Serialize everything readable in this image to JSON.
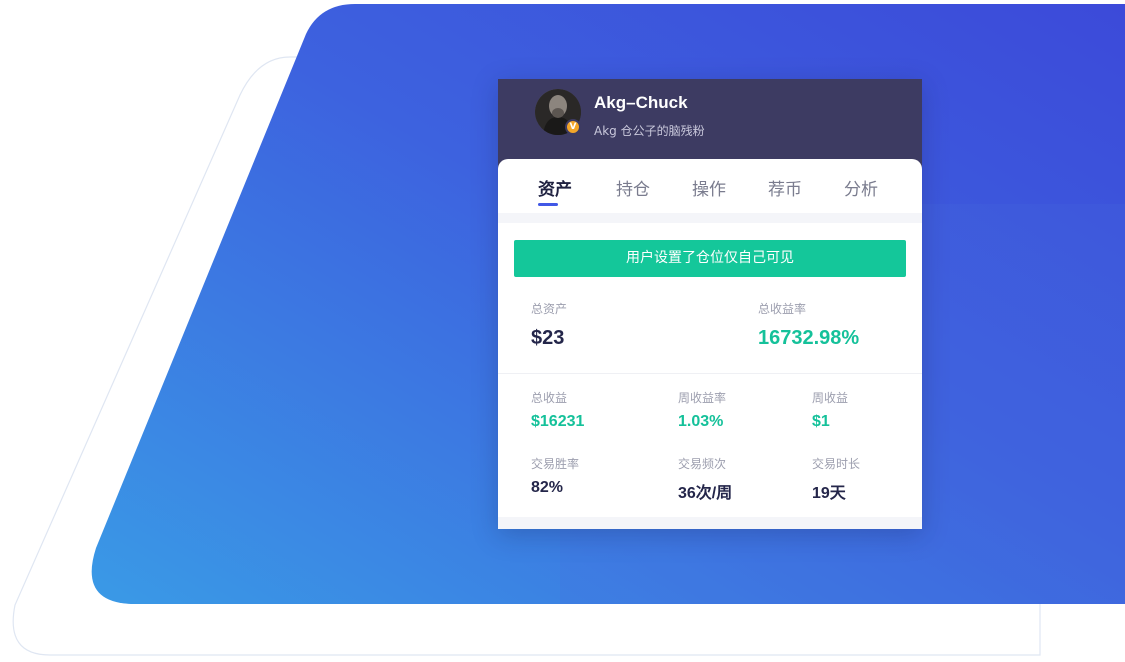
{
  "profile": {
    "name": "Akg–Chuck",
    "subtitle": "Akg 仓公子的脑残粉",
    "badge": "V"
  },
  "tabs": [
    {
      "label": "资产",
      "active": true
    },
    {
      "label": "持仓",
      "active": false
    },
    {
      "label": "操作",
      "active": false
    },
    {
      "label": "荐币",
      "active": false
    },
    {
      "label": "分析",
      "active": false
    }
  ],
  "notice": "用户设置了仓位仅自己可见",
  "summary": {
    "total_assets_label": "总资产",
    "total_assets_value": "$23",
    "total_return_rate_label": "总收益率",
    "total_return_rate_value": "16732.98%"
  },
  "stats": {
    "total_profit_label": "总收益",
    "total_profit_value": "$16231",
    "weekly_return_rate_label": "周收益率",
    "weekly_return_rate_value": "1.03%",
    "weekly_profit_label": "周收益",
    "weekly_profit_value": "$1",
    "win_rate_label": "交易胜率",
    "win_rate_value": "82%",
    "trade_frequency_label": "交易频次",
    "trade_frequency_value": "36次/周",
    "trade_duration_label": "交易时长",
    "trade_duration_value": "19天"
  },
  "colors": {
    "accent_green": "#15c19a",
    "header_bg": "#3d3b62",
    "tab_indicator": "#4158e6",
    "badge_orange": "#f3a629",
    "bg_gradient_start": "#3a8ee6",
    "bg_gradient_end": "#3c4bdc"
  }
}
